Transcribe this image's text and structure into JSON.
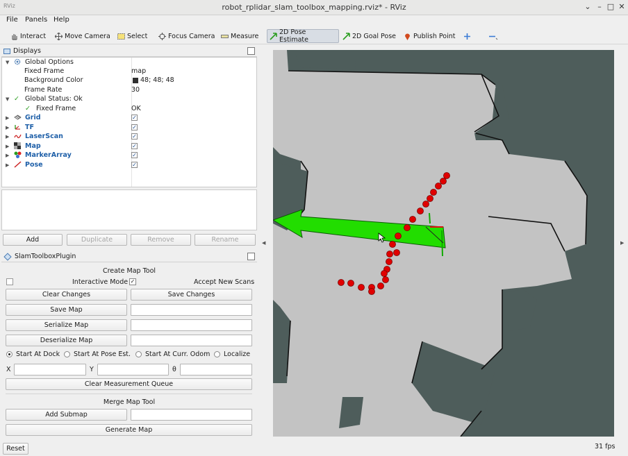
{
  "window": {
    "title": "robot_rplidar_slam_toolbox_mapping.rviz* - RViz"
  },
  "menu": [
    "File",
    "Panels",
    "Help"
  ],
  "toolbar": {
    "tools": [
      {
        "label": "Interact",
        "icon": "hand-icon"
      },
      {
        "label": "Move Camera",
        "icon": "move-camera-icon"
      },
      {
        "label": "Select",
        "icon": "select-icon"
      },
      {
        "label": "Focus Camera",
        "icon": "focus-camera-icon"
      },
      {
        "label": "Measure",
        "icon": "measure-icon"
      },
      {
        "label": "2D Pose Estimate",
        "icon": "green-arrow-icon",
        "active": true
      },
      {
        "label": "2D Goal Pose",
        "icon": "green-arrow-icon"
      },
      {
        "label": "Publish Point",
        "icon": "map-pin-icon"
      }
    ]
  },
  "displays": {
    "title": "Displays",
    "rows": [
      {
        "label": "Global Options",
        "value": ""
      },
      {
        "label": "Fixed Frame",
        "value": "map"
      },
      {
        "label": "Background Color",
        "value": "48; 48; 48"
      },
      {
        "label": "Frame Rate",
        "value": "30"
      },
      {
        "label": "Global Status: Ok",
        "value": ""
      },
      {
        "label": "Fixed Frame",
        "value": "OK"
      },
      {
        "label": "Grid",
        "value": "✓"
      },
      {
        "label": "TF",
        "value": "✓"
      },
      {
        "label": "LaserScan",
        "value": "✓"
      },
      {
        "label": "Map",
        "value": "✓"
      },
      {
        "label": "MarkerArray",
        "value": "✓"
      },
      {
        "label": "Pose",
        "value": "✓"
      }
    ],
    "background_color": "#303030",
    "buttons": {
      "add": "Add",
      "duplicate": "Duplicate",
      "remove": "Remove",
      "rename": "Rename"
    }
  },
  "slam": {
    "title": "SlamToolboxPlugin",
    "create_map_tool": "Create Map Tool",
    "interactive_mode": "Interactive Mode",
    "accept_new_scans": "Accept New Scans",
    "clear_changes": "Clear Changes",
    "save_changes": "Save Changes",
    "save_map": "Save Map",
    "serialize_map": "Serialize Map",
    "deserialize_map": "Deserialize Map",
    "radios": [
      "Start At Dock",
      "Start At Pose Est.",
      "Start At Curr. Odom",
      "Localize"
    ],
    "x": "X",
    "y": "Y",
    "theta": "θ",
    "clear_queue": "Clear Measurement Queue",
    "merge_map_tool": "Merge Map Tool",
    "add_submap": "Add Submap",
    "generate_map": "Generate Map"
  },
  "status": {
    "reset": "Reset",
    "fps": "31 fps"
  },
  "colors": {
    "accent_active": "#d8dde4",
    "marker": "#e00000",
    "pose_arrow": "#22dd00",
    "map_free": "#c3c3c3",
    "map_unknown": "#4e5d5b"
  }
}
